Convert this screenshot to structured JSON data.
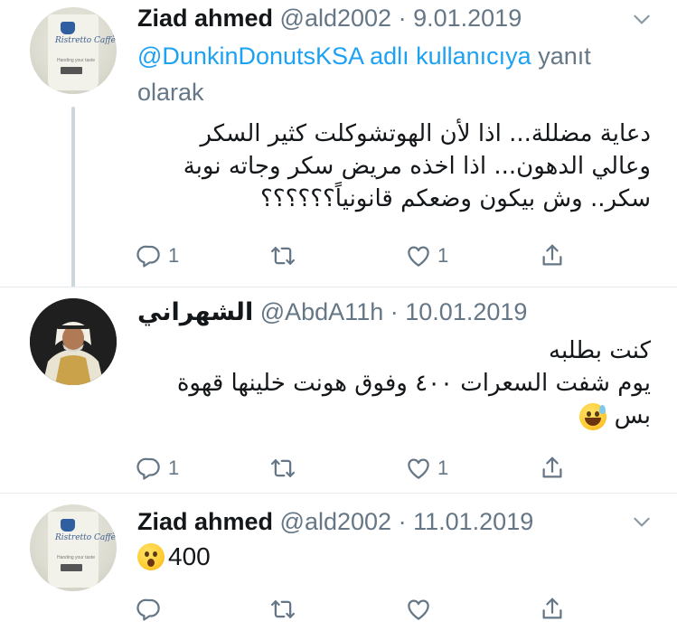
{
  "tweets": [
    {
      "name": "Ziad ahmed",
      "handle": "@ald2002",
      "separator": "·",
      "date": "9.01.2019",
      "reply_mention": "@DunkinDonutsKSA",
      "reply_suffix": "adlı kullanıcıya",
      "reply_tail_1": "yanıt",
      "reply_tail_2": "olarak",
      "text_lines": [
        "دعاية مضللة... اذا لأن الهوتشوكلت كثير السكر",
        "وعالي الدهون... اذا اخذه مريض سكر وجاته نوبة",
        "سكر.. وش بيكون وضعكم قانونياً؟؟؟؟؟؟"
      ],
      "replies": "1",
      "retweets": "",
      "likes": "1",
      "avatar_text": "Ristretto Caffè",
      "avatar_small": "Handing your taste"
    },
    {
      "name": "الشهراني",
      "handle": "@AbdA11h",
      "separator": "·",
      "date": "10.01.2019",
      "text_lines": [
        "كنت بطلبه",
        "يوم شفت السعرات ٤٠٠ وفوق هونت خلينها قهوة",
        "بس"
      ],
      "replies": "1",
      "retweets": "",
      "likes": "1"
    },
    {
      "name": "Ziad ahmed",
      "handle": "@ald2002",
      "separator": "·",
      "date": "11.01.2019",
      "text": "400",
      "replies": "",
      "retweets": "",
      "likes": "",
      "avatar_text": "Ristretto Caffè",
      "avatar_small": "Handing your taste"
    }
  ],
  "icons": {
    "reply": "reply-icon",
    "retweet": "retweet-icon",
    "like": "like-icon",
    "share": "share-icon",
    "caret": "chevron-down-icon"
  },
  "colors": {
    "text": "#14171a",
    "secondary": "#657786",
    "link": "#1da1f2",
    "thread_line": "#ccd6dd",
    "divider": "#e6ecf0"
  }
}
